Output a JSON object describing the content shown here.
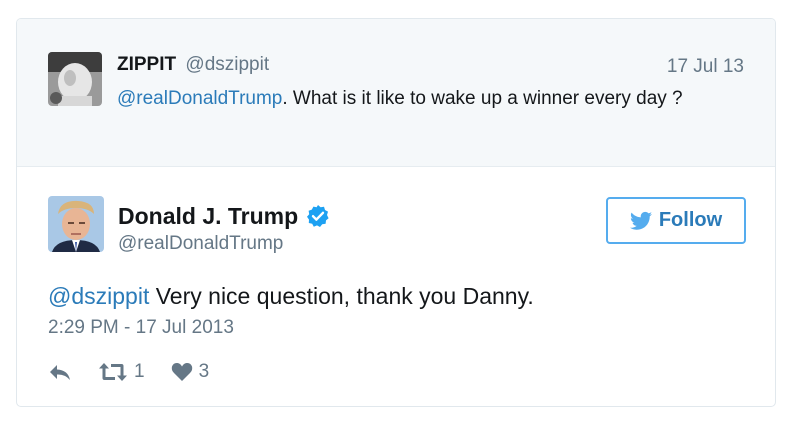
{
  "parent_tweet": {
    "author_name": "ZIPPIT",
    "author_handle": "@dszippit",
    "date": "17 Jul 13",
    "mention": "@realDonaldTrump",
    "text": ". What is it like to wake up a winner every day ?"
  },
  "main_tweet": {
    "author_name": "Donald J. Trump",
    "author_handle": "@realDonaldTrump",
    "verified_icon": "verified-badge-icon",
    "follow_label": "Follow",
    "mention": "@dszippit",
    "text": " Very nice question, thank you Danny.",
    "timestamp": "2:29 PM - 17 Jul 2013",
    "retweet_count": "1",
    "like_count": "3"
  },
  "icons": {
    "reply": "reply-icon",
    "retweet": "retweet-icon",
    "like": "heart-icon",
    "bird": "twitter-bird-icon"
  },
  "colors": {
    "link": "#2b7bb9",
    "follow_border": "#55acee",
    "muted": "#657786",
    "parent_bg": "#f5f8fa",
    "verified": "#1da1f2"
  }
}
